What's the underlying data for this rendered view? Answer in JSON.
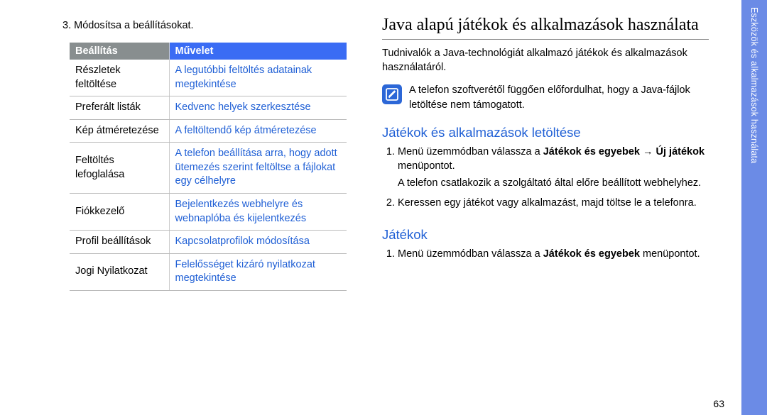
{
  "left": {
    "step_text": "3.  Módosítsa a beállításokat.",
    "table": {
      "header_setting": "Beállítás",
      "header_action": "Művelet",
      "rows": [
        {
          "setting": "Részletek feltöltése",
          "action": "A legutóbbi feltöltés adatainak megtekintése"
        },
        {
          "setting": "Preferált listák",
          "action": "Kedvenc helyek szerkesztése"
        },
        {
          "setting": "Kép átméretezése",
          "action": "A feltöltendő kép átméretezése"
        },
        {
          "setting": "Feltöltés lefoglalása",
          "action": "A telefon beállítása arra, hogy adott ütemezés szerint feltöltse a fájlokat egy célhelyre"
        },
        {
          "setting": "Fiókkezelő",
          "action": "Bejelentkezés webhelyre és webnaplóba és kijelentkezés"
        },
        {
          "setting": "Profil beállítások",
          "action": "Kapcsolatprofilok módosítása"
        },
        {
          "setting": "Jogi Nyilatkozat",
          "action": "Felelősséget kizáró nyilatkozat megtekintése"
        }
      ]
    }
  },
  "right": {
    "heading": "Java alapú játékok és alkalmazások használata",
    "intro": "Tudnivalók a Java-technológiát alkalmazó játékok és alkalmazások használatáról.",
    "note": "A telefon szoftverétől függően előfordulhat, hogy a Java-fájlok letöltése nem támogatott.",
    "section1": {
      "title": "Játékok és alkalmazások letöltése",
      "li1_pre": "Menü üzemmódban válassza a ",
      "li1_b1": "Játékok és egyebek",
      "li1_mid": " → ",
      "li1_b2": "Új játékok",
      "li1_suf": " menüpontot.",
      "li1_sub": "A telefon csatlakozik a szolgáltató által előre beállított webhelyhez.",
      "li2": "Keressen egy játékot vagy alkalmazást, majd töltse le a telefonra."
    },
    "section2": {
      "title": "Játékok",
      "li1_pre": "Menü üzemmódban válassza a ",
      "li1_b1": "Játékok és egyebek",
      "li1_suf": " menüpontot."
    }
  },
  "sidebar": {
    "label": "Eszközök és alkalmazások használata"
  },
  "page_number": "63"
}
